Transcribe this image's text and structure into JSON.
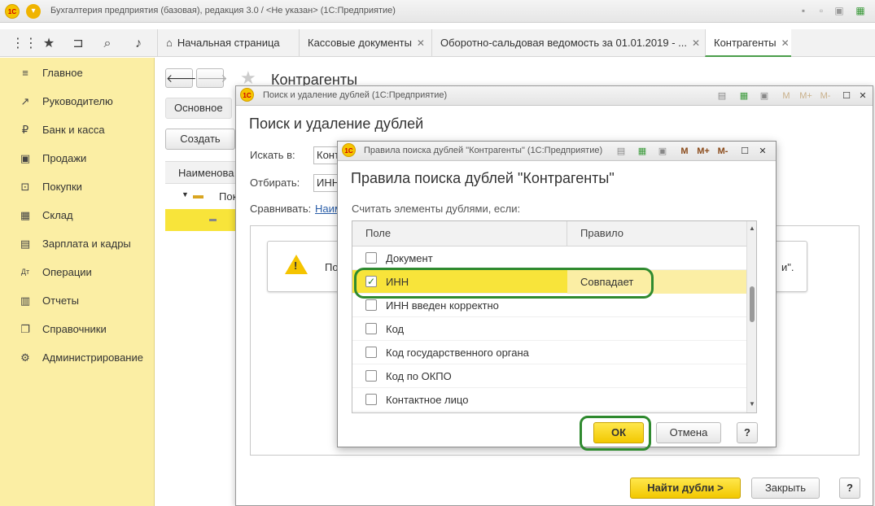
{
  "window": {
    "title": "Бухгалтерия предприятия (базовая), редакция 3.0 / <Не указан>  (1С:Предприятие)",
    "logo": "1С"
  },
  "tabs": [
    {
      "label": "Начальная страница"
    },
    {
      "label": "Кассовые документы"
    },
    {
      "label": "Оборотно-сальдовая ведомость за 01.01.2019 - ..."
    },
    {
      "label": "Контрагенты"
    }
  ],
  "sidebar": {
    "items": [
      {
        "label": "Главное",
        "icon": "≡"
      },
      {
        "label": "Руководителю",
        "icon": "↗"
      },
      {
        "label": "Банк и касса",
        "icon": "₽"
      },
      {
        "label": "Продажи",
        "icon": "▣"
      },
      {
        "label": "Покупки",
        "icon": "⊡"
      },
      {
        "label": "Склад",
        "icon": "▦"
      },
      {
        "label": "Зарплата и кадры",
        "icon": "▤"
      },
      {
        "label": "Операции",
        "icon": "Дт"
      },
      {
        "label": "Отчеты",
        "icon": "▥"
      },
      {
        "label": "Справочники",
        "icon": "❐"
      },
      {
        "label": "Администрирование",
        "icon": "⚙"
      }
    ]
  },
  "bg": {
    "title": "Контрагенты",
    "main_btn": "Основное",
    "create_btn": "Создать",
    "col_name": "Наименова",
    "folder_label": "Пок"
  },
  "dialog1": {
    "window_title": "Поиск и удаление дублей  (1С:Предприятие)",
    "title": "Поиск и удаление дублей",
    "search_in_label": "Искать в:",
    "search_in_value": "Конт",
    "filter_label": "Отбирать:",
    "filter_value": "ИНН",
    "compare_label": "Сравнивать:",
    "compare_link": "Наим",
    "warning_text": "По",
    "warning_tail": "и\".",
    "find_btn": "Найти дубли >",
    "close_btn": "Закрыть",
    "help_btn": "?"
  },
  "dialog2": {
    "window_title": "Правила поиска дублей \"Контрагенты\"  (1С:Предприятие)",
    "title": "Правила поиска дублей \"Контрагенты\"",
    "subtitle": "Считать элементы дублями, если:",
    "col_field": "Поле",
    "col_rule": "Правило",
    "rows": [
      {
        "label": "Документ",
        "checked": false,
        "rule": ""
      },
      {
        "label": "ИНН",
        "checked": true,
        "rule": "Совпадает"
      },
      {
        "label": "ИНН введен корректно",
        "checked": false,
        "rule": ""
      },
      {
        "label": "Код",
        "checked": false,
        "rule": ""
      },
      {
        "label": "Код государственного органа",
        "checked": false,
        "rule": ""
      },
      {
        "label": "Код по ОКПО",
        "checked": false,
        "rule": ""
      },
      {
        "label": "Контактное лицо",
        "checked": false,
        "rule": ""
      }
    ],
    "check_mark": "✓",
    "ok_btn": "ОК",
    "cancel_btn": "Отмена",
    "help_btn": "?",
    "header_icons": {
      "m": "M",
      "mplus": "M+",
      "mminus": "M-"
    }
  },
  "colors": {
    "sidebar_bg": "#fbeea4",
    "selected_row": "#f8e43a",
    "highlight_outline": "#2f8a2f",
    "primary_button": "#f2c800"
  }
}
